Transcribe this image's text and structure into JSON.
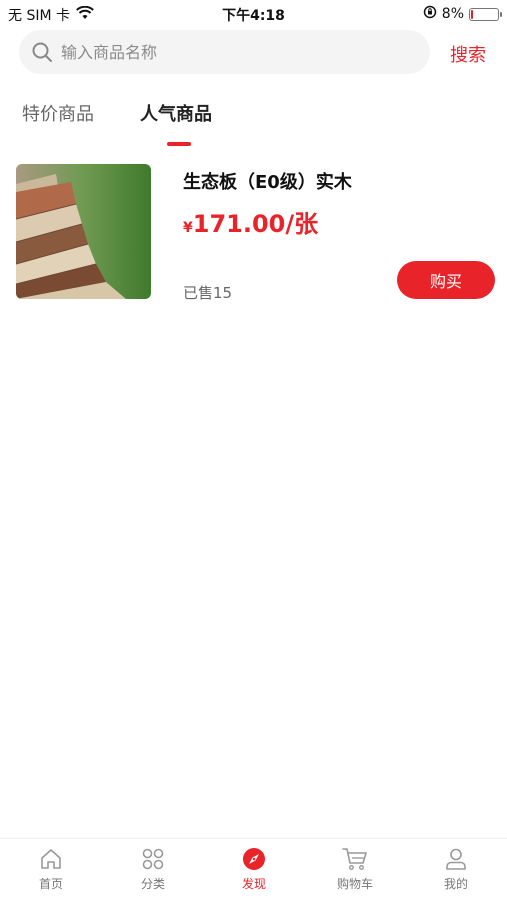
{
  "status_bar": {
    "carrier": "无 SIM 卡",
    "time": "下午4:18",
    "battery_percent": "8%",
    "battery_level": 0.08
  },
  "search": {
    "placeholder": "输入商品名称",
    "button_label": "搜索"
  },
  "tabs": {
    "special": "特价商品",
    "popular": "人气商品",
    "active": "popular"
  },
  "product": {
    "name": "生态板（E0级）实木",
    "currency_symbol": "¥",
    "price": "171.00/张",
    "sold": "已售15",
    "buy_label": "购买"
  },
  "bottom_nav": {
    "home": "首页",
    "category": "分类",
    "discover": "发现",
    "cart": "购物车",
    "mine": "我的",
    "active": "discover"
  },
  "colors": {
    "accent": "#e8232a",
    "inactive": "#777777",
    "search_bg": "#f4f4f4"
  }
}
